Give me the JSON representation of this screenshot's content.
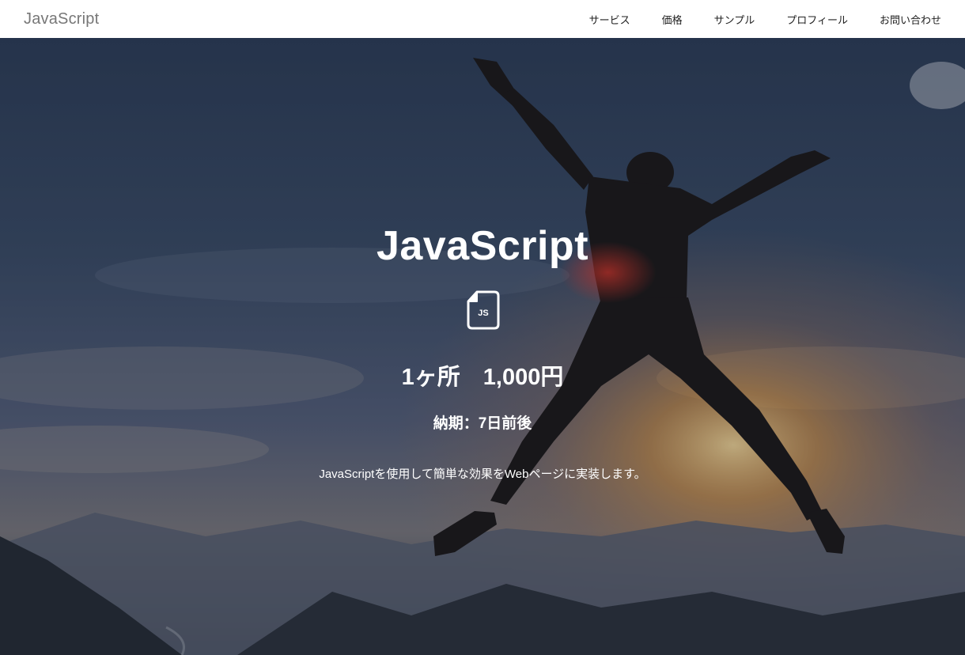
{
  "header": {
    "brand": "JavaScript",
    "nav": [
      {
        "label": "サービス"
      },
      {
        "label": "価格"
      },
      {
        "label": "サンプル"
      },
      {
        "label": "プロフィール"
      },
      {
        "label": "お問い合わせ"
      }
    ]
  },
  "hero": {
    "title": "JavaScript",
    "icon": {
      "name": "js-file-icon",
      "text": "JS"
    },
    "price": "1ヶ所　1,000円",
    "delivery": "納期：7日前後",
    "description": "JavaScriptを使用して簡単な効果をWebページに実装します。"
  },
  "colors": {
    "header_bg": "#ffffff",
    "brand_text": "#777777",
    "nav_text": "#222222",
    "hero_text": "#ffffff",
    "sky_top": "#2c3c55",
    "sunset": "#e89a3c"
  }
}
